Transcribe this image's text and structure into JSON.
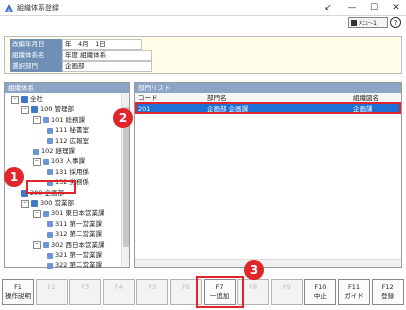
{
  "window": {
    "title": "組織体系登録",
    "controls": [
      "↙",
      "—",
      "☐",
      "✕"
    ]
  },
  "toolbar": {
    "menu_label": "ﾒﾆｭｰ-1",
    "help": "?"
  },
  "header": {
    "fields": [
      {
        "label": "改編年月日",
        "value": "年　4月　1日"
      },
      {
        "label": "組織体系名",
        "value": "年度 組織体系"
      },
      {
        "label": "選択部門",
        "value": "企画部"
      }
    ]
  },
  "tree": {
    "title": "組織体系",
    "items": [
      {
        "label": "全社",
        "level": 0,
        "box": "−"
      },
      {
        "label": "100 管理部",
        "level": 1,
        "box": "−"
      },
      {
        "label": "101 総務課",
        "level": 2,
        "box": "−"
      },
      {
        "label": "111 秘書室",
        "level": 3,
        "box": ""
      },
      {
        "label": "112 広報室",
        "level": 3,
        "box": ""
      },
      {
        "label": "102 経理課",
        "level": 2,
        "box": ""
      },
      {
        "label": "103 人事課",
        "level": 2,
        "box": "−"
      },
      {
        "label": "131 採用係",
        "level": 3,
        "box": ""
      },
      {
        "label": "132 労務係",
        "level": 3,
        "box": ""
      },
      {
        "label": "200 企画部",
        "level": 1,
        "box": ""
      },
      {
        "label": "300 営業部",
        "level": 1,
        "box": "−"
      },
      {
        "label": "301 東日本営業課",
        "level": 2,
        "box": "−"
      },
      {
        "label": "311 第一営業課",
        "level": 3,
        "box": ""
      },
      {
        "label": "312 第二営業課",
        "level": 3,
        "box": ""
      },
      {
        "label": "302 西日本営業課",
        "level": 2,
        "box": "−"
      },
      {
        "label": "321 第一営業課",
        "level": 3,
        "box": ""
      },
      {
        "label": "322 第二営業課",
        "level": 3,
        "box": ""
      }
    ]
  },
  "list": {
    "title": "部門リスト",
    "columns": [
      "コード",
      "部門名",
      "組織図名"
    ],
    "rows": [
      {
        "code": "201",
        "name": "企画部 企画課",
        "chart_name": "企画課"
      }
    ]
  },
  "fkeys": [
    {
      "key": "F1",
      "label": "操作説明",
      "state": "active"
    },
    {
      "key": "F2",
      "label": "",
      "state": "dim"
    },
    {
      "key": "F3",
      "label": "",
      "state": "dim"
    },
    {
      "key": "F4",
      "label": "",
      "state": "dim"
    },
    {
      "key": "F5",
      "label": "",
      "state": "dim"
    },
    {
      "key": "F6",
      "label": "",
      "state": "dim"
    },
    {
      "key": "F7",
      "label": "一追加",
      "state": "active"
    },
    {
      "key": "F8",
      "label": "",
      "state": "dim"
    },
    {
      "key": "F9",
      "label": "",
      "state": "dim"
    },
    {
      "key": "F10",
      "label": "中止",
      "state": "active"
    },
    {
      "key": "F11",
      "label": "ガイド",
      "state": "active"
    },
    {
      "key": "F12",
      "label": "登録",
      "state": "active"
    }
  ],
  "annotations": [
    "1",
    "2",
    "3"
  ],
  "colors": {
    "accent_red": "#e0262a",
    "selection_blue": "#1e6fd6",
    "panel_header": "#8ca4c6"
  }
}
